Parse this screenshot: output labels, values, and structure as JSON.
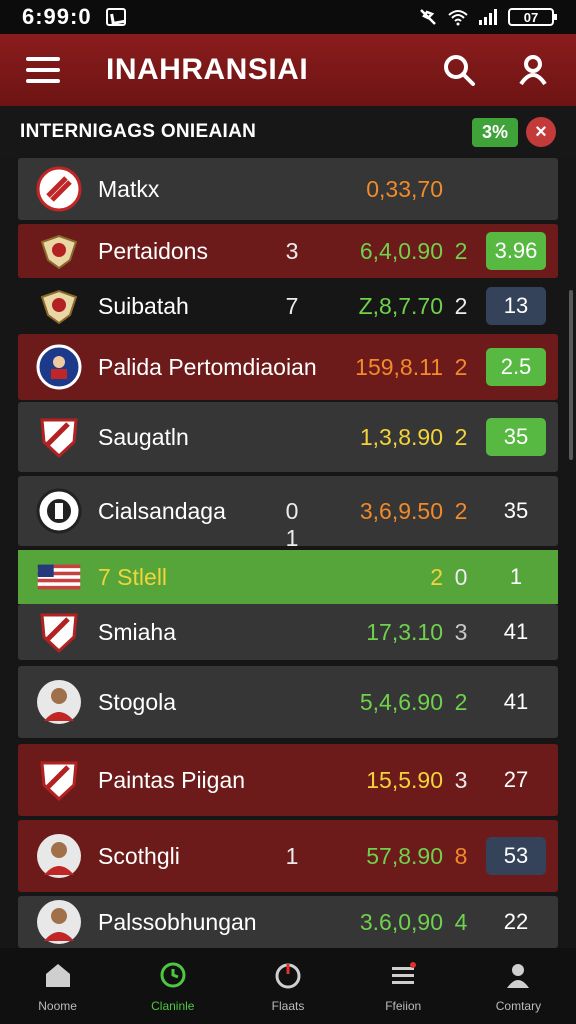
{
  "status": {
    "time": "6:99:0",
    "battery": "07"
  },
  "app_bar": {
    "title": "INAHRANSIAI"
  },
  "section": {
    "title": "INTERNIGAGS ONIEAIAN",
    "badge": "3%",
    "close_symbol": "×"
  },
  "rows": [
    {
      "name": "Matkx",
      "col1": "",
      "odds": "0,33,70",
      "col3": "",
      "pill": "",
      "style": "dark",
      "odds_color": "orange",
      "col3_color": "white",
      "pill_color": "none",
      "logo": "striped-crest-icon"
    },
    {
      "name": "Pertaidons",
      "col1": "3",
      "odds": "6,4,0.90",
      "col3": "2",
      "pill": "3.96",
      "style": "red",
      "odds_color": "green",
      "col3_color": "green",
      "pill_color": "green",
      "logo": "wing-crest-icon"
    },
    {
      "name": "Suibatah",
      "col1": "7",
      "odds": "Z,8,7.70",
      "col3": "2",
      "pill": "13",
      "style": "plain",
      "odds_color": "green",
      "col3_color": "white",
      "pill_color": "navy",
      "logo": "wing-crest-icon"
    },
    {
      "name": "Palida Pertomdiaoian",
      "col1": "",
      "odds": "159,8.11",
      "col3": "2",
      "pill": "2.5",
      "style": "red",
      "odds_color": "orange",
      "col3_color": "orange",
      "pill_color": "green",
      "logo": "player-badge-icon"
    },
    {
      "name": "Saugatln",
      "col1": "",
      "odds": "1,3,8.90",
      "col3": "2",
      "pill": "35",
      "style": "dark",
      "odds_color": "yellow",
      "col3_color": "yellow",
      "pill_color": "green",
      "logo": "shield-crest-icon"
    },
    {
      "name": "Cialsandaga",
      "col1": "0 1",
      "odds": "3,6,9.50",
      "col3": "2",
      "pill": "35",
      "style": "dark",
      "odds_color": "orange",
      "col3_color": "orange",
      "pill_color": "none",
      "logo": "round-crest-icon"
    },
    {
      "name": "7 Stlell",
      "col1": "",
      "odds": "2",
      "col3": "0",
      "pill": "1",
      "style": "green",
      "odds_color": "yellow",
      "col3_color": "white",
      "pill_color": "none",
      "logo": "flag-icon"
    },
    {
      "name": "Smiaha",
      "col1": "",
      "odds": "17,3.10",
      "col3": "3",
      "pill": "41",
      "style": "dark",
      "odds_color": "green",
      "col3_color": "grey",
      "pill_color": "none",
      "logo": "shield-crest-icon"
    },
    {
      "name": "Stogola",
      "col1": "",
      "odds": "5,4,6.90",
      "col3": "2",
      "pill": "41",
      "style": "dark",
      "odds_color": "green",
      "col3_color": "green",
      "pill_color": "none",
      "logo": "player-photo-icon"
    },
    {
      "name": "Paintas Piigan",
      "col1": "",
      "odds": "15,5.90",
      "col3": "3",
      "pill": "27",
      "style": "red",
      "odds_color": "yellow",
      "col3_color": "white",
      "pill_color": "none",
      "logo": "shield-crest-icon"
    },
    {
      "name": "Scothgli",
      "col1": "1",
      "odds": "57,8.90",
      "col3": "8",
      "pill": "53",
      "style": "red",
      "odds_color": "green",
      "col3_color": "orange",
      "pill_color": "navy",
      "logo": "player-photo-icon"
    },
    {
      "name": "Palssobhungan",
      "col1": "",
      "odds": "3.6,0,90",
      "col3": "4",
      "pill": "22",
      "style": "dark",
      "odds_color": "green",
      "col3_color": "green",
      "pill_color": "none",
      "logo": "player-photo-icon"
    }
  ],
  "nav": [
    {
      "label": "Noome",
      "icon": "home-icon"
    },
    {
      "label": "Claninle",
      "icon": "refresh-clock-icon"
    },
    {
      "label": "Flaats",
      "icon": "power-timer-icon"
    },
    {
      "label": "Ffeiion",
      "icon": "list-menu-icon"
    },
    {
      "label": "Comtary",
      "icon": "profile-icon"
    }
  ],
  "colors": {
    "appbar": "#7a1818",
    "accent_green": "#57b941",
    "accent_red": "#c23a3a"
  }
}
